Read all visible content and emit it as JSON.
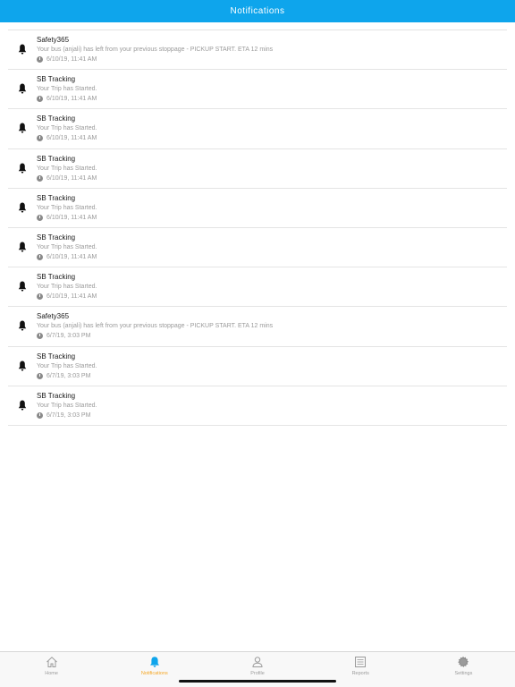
{
  "header": {
    "title": "Notifications"
  },
  "notifications": [
    {
      "sender": "Safety365",
      "message": "Your bus (anjali) has left from your previous stoppage - PICKUP START. ETA 12 mins",
      "time": "6/10/19, 11:41 AM"
    },
    {
      "sender": "SB Tracking",
      "message": "Your Trip has Started.",
      "time": "6/10/19, 11:41 AM"
    },
    {
      "sender": "SB Tracking",
      "message": "Your Trip has Started.",
      "time": "6/10/19, 11:41 AM"
    },
    {
      "sender": "SB Tracking",
      "message": "Your Trip has Started.",
      "time": "6/10/19, 11:41 AM"
    },
    {
      "sender": "SB Tracking",
      "message": "Your Trip has Started.",
      "time": "6/10/19, 11:41 AM"
    },
    {
      "sender": "SB Tracking",
      "message": "Your Trip has Started.",
      "time": "6/10/19, 11:41 AM"
    },
    {
      "sender": "SB Tracking",
      "message": "Your Trip has Started.",
      "time": "6/10/19, 11:41 AM"
    },
    {
      "sender": "Safety365",
      "message": "Your bus (anjali) has left from your previous stoppage - PICKUP START. ETA 12 mins",
      "time": "6/7/19, 3:03 PM"
    },
    {
      "sender": "SB Tracking",
      "message": "Your Trip has Started.",
      "time": "6/7/19, 3:03 PM"
    },
    {
      "sender": "SB Tracking",
      "message": "Your Trip has Started.",
      "time": "6/7/19, 3:03 PM"
    }
  ],
  "tabbar": {
    "items": [
      {
        "label": "Home",
        "icon": "home-icon"
      },
      {
        "label": "Notifications",
        "icon": "bell-icon",
        "active": true
      },
      {
        "label": "Profile",
        "icon": "person-icon"
      },
      {
        "label": "Reports",
        "icon": "list-icon"
      },
      {
        "label": "Settings",
        "icon": "gear-icon"
      }
    ]
  },
  "colors": {
    "accent": "#0ea5ec",
    "active_tab": "#f5a623"
  }
}
